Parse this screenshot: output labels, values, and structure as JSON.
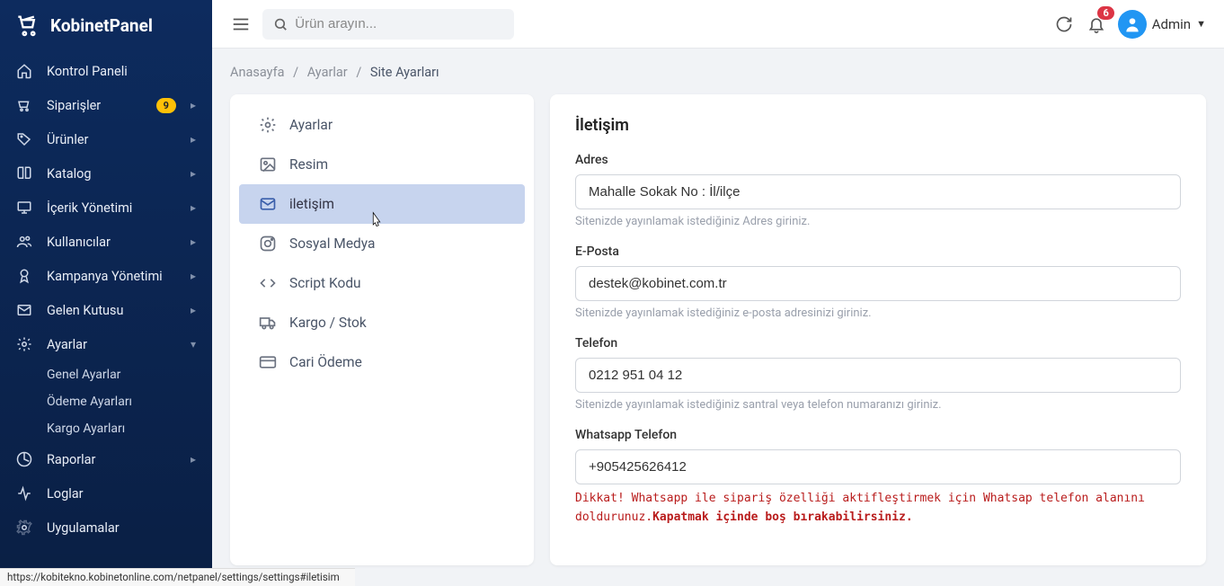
{
  "brand": "KobinetPanel",
  "search": {
    "placeholder": "Ürün arayın..."
  },
  "notifications": {
    "count": "6"
  },
  "user": {
    "name": "Admin"
  },
  "sidebar": {
    "items": [
      {
        "label": "Kontrol Paneli",
        "chev": false
      },
      {
        "label": "Siparişler",
        "badge": "9",
        "chev": true
      },
      {
        "label": "Ürünler",
        "chev": true
      },
      {
        "label": "Katalog",
        "chev": true
      },
      {
        "label": "İçerik Yönetimi",
        "chev": true
      },
      {
        "label": "Kullanıcılar",
        "chev": true
      },
      {
        "label": "Kampanya Yönetimi",
        "chev": true
      },
      {
        "label": "Gelen Kutusu",
        "chev": true
      },
      {
        "label": "Ayarlar",
        "chev": true,
        "expanded": true
      },
      {
        "label": "Raporlar",
        "chev": true
      },
      {
        "label": "Loglar",
        "chev": false
      },
      {
        "label": "Uygulamalar",
        "chev": false
      }
    ],
    "sub": [
      {
        "label": "Genel Ayarlar"
      },
      {
        "label": "Ödeme Ayarları"
      },
      {
        "label": "Kargo Ayarları"
      }
    ]
  },
  "crumb": {
    "a": "Anasayfa",
    "b": "Ayarlar",
    "c": "Site Ayarları"
  },
  "settings_tabs": [
    {
      "label": "Ayarlar"
    },
    {
      "label": "Resim"
    },
    {
      "label": "iletişim"
    },
    {
      "label": "Sosyal Medya"
    },
    {
      "label": "Script Kodu"
    },
    {
      "label": "Kargo / Stok"
    },
    {
      "label": "Cari Ödeme"
    }
  ],
  "form": {
    "title": "İletişim",
    "adres": {
      "label": "Adres",
      "value": "Mahalle Sokak No : İl/ilçe",
      "help": "Sitenizde yayınlamak istediğiniz Adres giriniz."
    },
    "eposta": {
      "label": "E-Posta",
      "value": "destek@kobinet.com.tr",
      "help": "Sitenizde yayınlamak istediğiniz e-posta adresinizi giriniz."
    },
    "telefon": {
      "label": "Telefon",
      "value": "0212 951 04 12",
      "help": "Sitenizde yayınlamak istediğiniz santral veya telefon numaranızı giriniz."
    },
    "whatsapp": {
      "label": "Whatsapp Telefon",
      "value": "+905425626412",
      "warn1": "Dikkat! Whatsapp ile sipariş özelliği aktifleştirmek için Whatsap telefon alanını doldurunuz.",
      "warn2": "Kapatmak içinde boş bırakabilirsiniz."
    }
  },
  "status_url": "https://kobitekno.kobinetonline.com/netpanel/settings/settings#iletisim"
}
